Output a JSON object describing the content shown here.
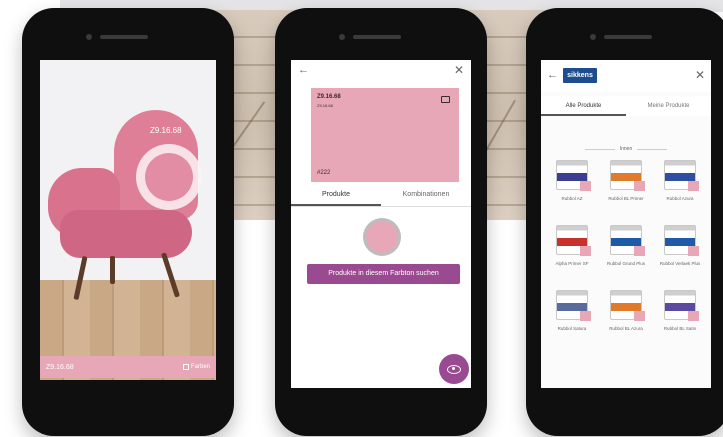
{
  "phone_ar": {
    "color_code": "Z9.16.68",
    "bottom_code": "Z9.16.68",
    "farben_label": "Farben"
  },
  "phone_detail": {
    "swatch_code": "Z9.16.68",
    "swatch_sub": "Z9.16.68",
    "swatch_number": "#222",
    "tabs": [
      "Produkte",
      "Kombinationen"
    ],
    "search_button": "Produkte in diesem Farbton suchen",
    "swatch_color": "#e8a7b6",
    "accent_color": "#9a4a91"
  },
  "phone_products": {
    "brand": "sikkens",
    "tabs": [
      "Alle Produkte",
      "Meine Produkte"
    ],
    "section": "Innen",
    "products": [
      {
        "name": "Rubbol AZ",
        "band": "#3b3f8f"
      },
      {
        "name": "Rubbol BL Primer",
        "band": "#e07b2c"
      },
      {
        "name": "Rubbol Azura",
        "band": "#2f4ea1"
      },
      {
        "name": "Alpha Primer SF",
        "band": "#c8322e"
      },
      {
        "name": "Rubbol Grund Plus",
        "band": "#1e5aa8"
      },
      {
        "name": "Rubbol Verlaek Plus",
        "band": "#1e5aa8"
      },
      {
        "name": "Rubbol Satura",
        "band": "#5a6c9c"
      },
      {
        "name": "Rubbol BL Azura",
        "band": "#e07b2c"
      },
      {
        "name": "Rubbol BL Satin",
        "band": "#5a4aa0"
      }
    ]
  }
}
